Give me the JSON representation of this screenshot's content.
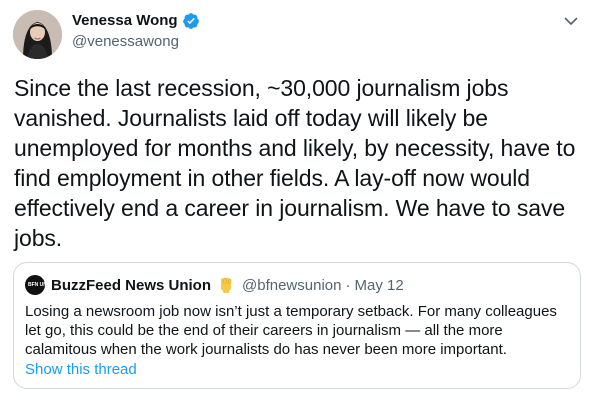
{
  "author": {
    "display_name": "Venessa Wong",
    "handle": "@venessawong",
    "verified": true
  },
  "tweet": {
    "text": "Since the last recession, ~30,000 journalism jobs vanished. Journalists laid off today will likely be unemployed for months and likely, by necessity, have to find employment in other fields. A lay-off now would effectively end a career in journalism. We have to save jobs."
  },
  "quoted_tweet": {
    "avatar_text": "BFN UNION",
    "display_name": "BuzzFeed News Union",
    "emoji_icon": "raised-fist",
    "handle": "@bfnewsunion",
    "separator": "·",
    "date": "May 12",
    "text": "Losing a newsroom job now isn’t just a temporary setback. For many colleagues let go, this could be the end of their careers in journalism — all the more calamitous when the work journalists do has never been more important.",
    "show_thread_label": "Show this thread"
  },
  "icons": {
    "verified": "verified-badge-icon",
    "menu": "chevron-down-icon"
  },
  "colors": {
    "accent": "#1d9bf0",
    "text_primary": "#0f1419",
    "text_secondary": "#536471",
    "border": "#cfd9de",
    "fist_emoji": "#f7c948"
  }
}
